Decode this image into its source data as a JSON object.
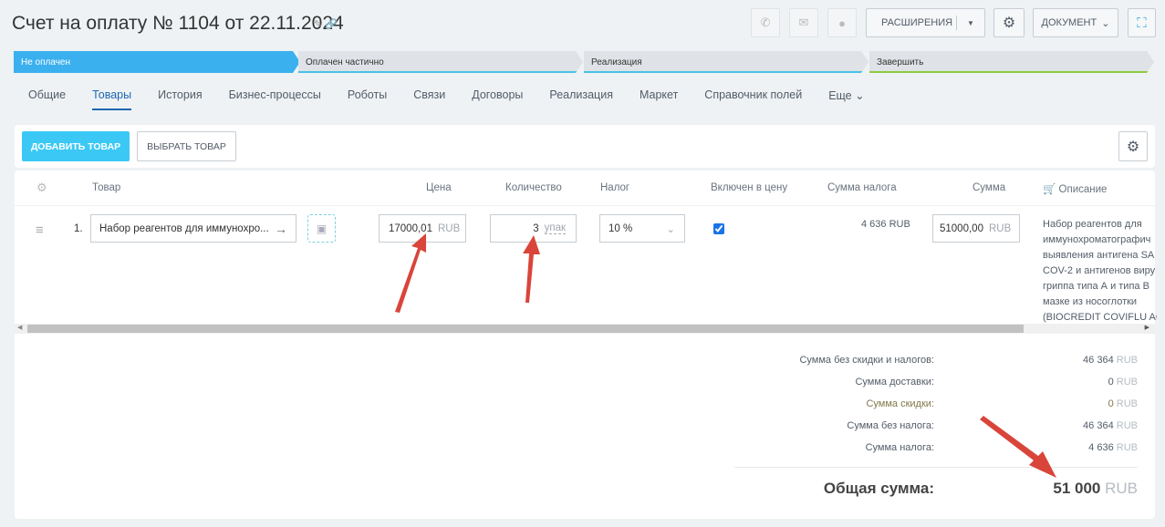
{
  "header": {
    "title": "Счет на оплату № 1104 от 22.11.2024",
    "extensions_label": "РАСШИРЕНИЯ",
    "document_label": "ДОКУМЕНТ"
  },
  "stages": [
    {
      "label": "Не оплачен",
      "color": "#3bb0ee",
      "active": true
    },
    {
      "label": "Оплачен частично",
      "color": "#47c3e6"
    },
    {
      "label": "Реализация",
      "color": "#47c3e6"
    },
    {
      "label": "Завершить",
      "color": "#8ecb3f"
    }
  ],
  "tabs": [
    "Общие",
    "Товары",
    "История",
    "Бизнес-процессы",
    "Роботы",
    "Связи",
    "Договоры",
    "Реализация",
    "Маркет",
    "Справочник полей",
    "Еще"
  ],
  "toolbar": {
    "add_label": "ДОБАВИТЬ ТОВАР",
    "select_label": "ВЫБРАТЬ ТОВАР"
  },
  "table": {
    "headers": {
      "product": "Товар",
      "price": "Цена",
      "quantity": "Количество",
      "tax": "Налог",
      "included": "Включен в цену",
      "tax_sum": "Сумма налога",
      "sum": "Сумма",
      "description": "Описание"
    },
    "row": {
      "index": "1.",
      "product": "Набор реагентов для иммунохро...",
      "price": "17000,01",
      "currency": "RUB",
      "quantity": "3",
      "unit": "упак",
      "tax": "10 %",
      "included": true,
      "tax_sum": "4 636 RUB",
      "sum": "51000,00",
      "description": [
        "Набор реагентов для",
        "иммунохроматографич",
        "выявления антигена SA",
        "COV-2 и антигенов виру",
        "гриппа типа А и типа В",
        "мазке из носоглотки",
        "(BIOCREDIT COVIFLU AG"
      ]
    }
  },
  "summary": {
    "rows": [
      {
        "label": "Сумма без скидки и налогов:",
        "value": "46 364",
        "currency": "RUB"
      },
      {
        "label": "Сумма доставки:",
        "value": "0",
        "currency": "RUB"
      },
      {
        "label": "Сумма скидки:",
        "value": "0",
        "currency": "RUB"
      },
      {
        "label": "Сумма без налога:",
        "value": "46 364",
        "currency": "RUB"
      },
      {
        "label": "Сумма налога:",
        "value": "4 636",
        "currency": "RUB"
      }
    ],
    "total_label": "Общая сумма:",
    "total_value": "51 000",
    "total_currency": "RUB"
  }
}
